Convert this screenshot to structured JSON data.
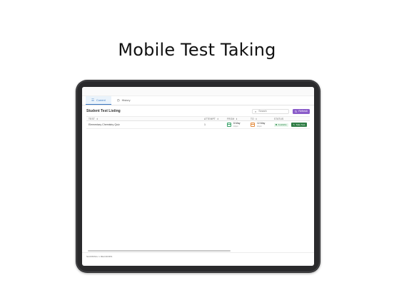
{
  "headline": "Mobile Test Taking",
  "tabs": [
    {
      "label": "Current",
      "icon": "list-icon",
      "active": true
    },
    {
      "label": "History",
      "icon": "clock-icon",
      "active": false
    }
  ],
  "listing": {
    "title": "Student Test Listing",
    "search_placeholder": "Search",
    "refresh_label": "Refresh"
  },
  "table": {
    "columns": [
      {
        "label": "TEST",
        "sortable": true
      },
      {
        "label": "ATTEMPT",
        "sortable": true
      },
      {
        "label": "FROM",
        "sortable": true
      },
      {
        "label": "TO",
        "sortable": true
      },
      {
        "label": "STATUS",
        "sortable": false
      },
      {
        "label": "",
        "sortable": false
      }
    ],
    "rows": [
      {
        "test": "Elementary Chemistry Quiz",
        "attempt": "1",
        "from_date": "8-May",
        "from_sub": "10pm",
        "to_date": "12-May",
        "to_sub": "10pm",
        "status": "Available",
        "action": "Take Test"
      }
    ]
  },
  "footer": {
    "count": "SHOWING 1 RECORDS"
  },
  "colors": {
    "accent": "#8a5cc9",
    "available": "#2c8a4a",
    "take_button": "#2f7d45",
    "tab_active": "#3a78c2"
  }
}
